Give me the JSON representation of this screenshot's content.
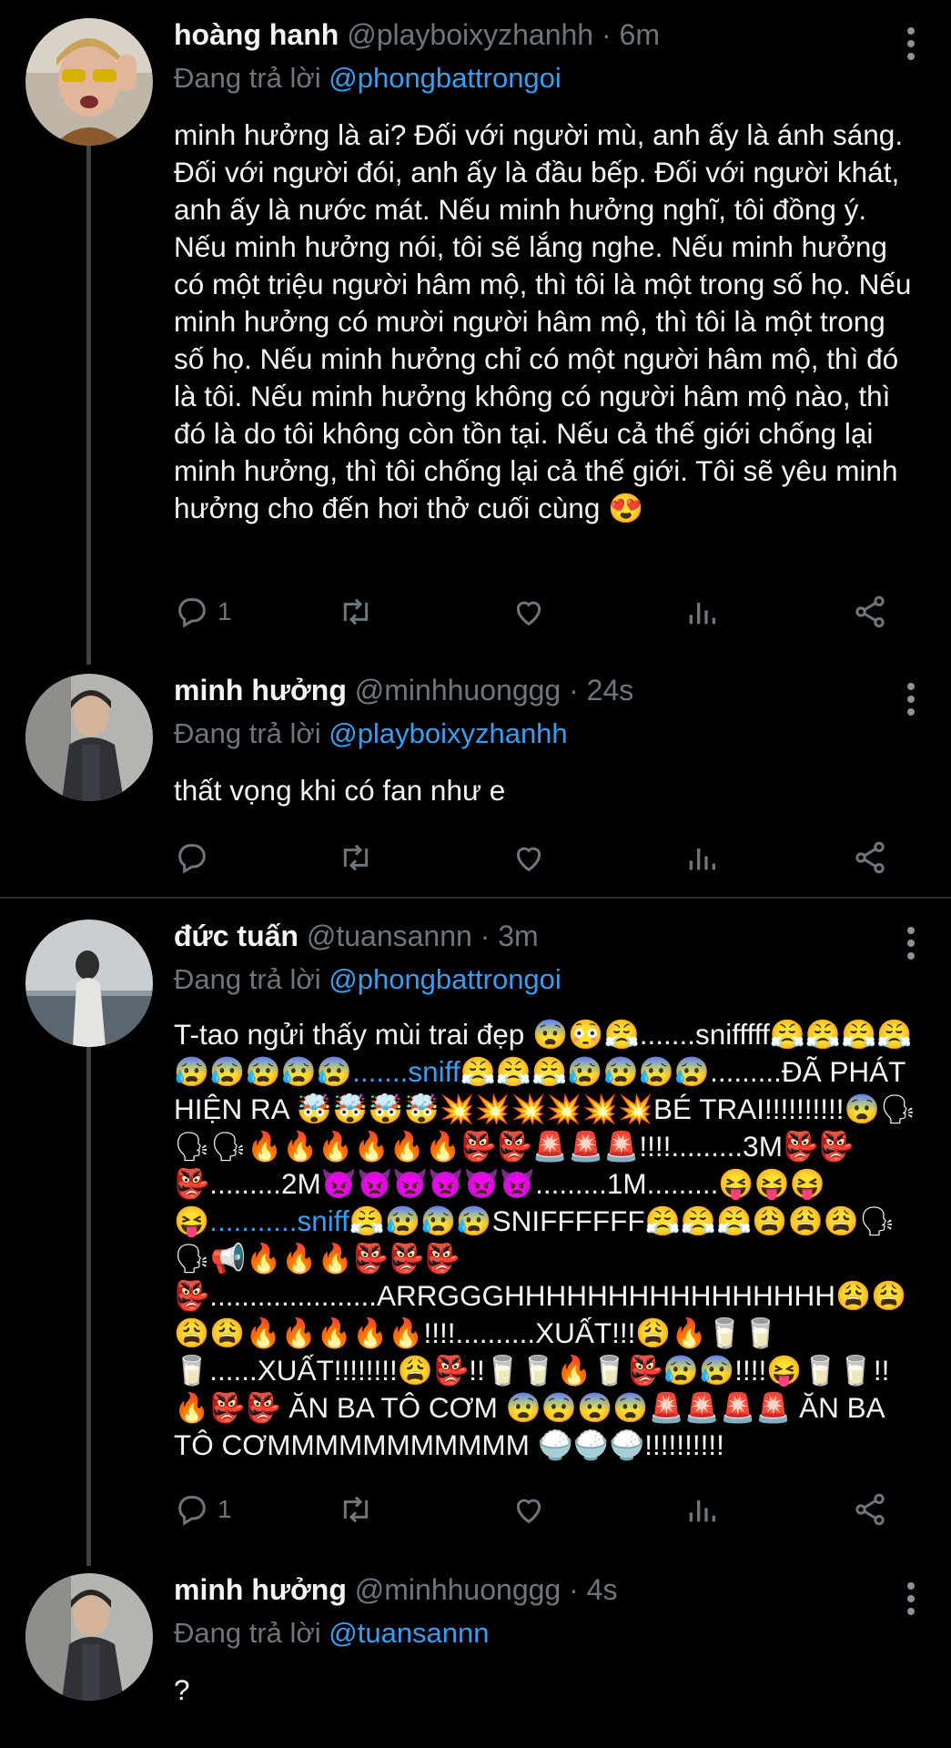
{
  "tweets": [
    {
      "name": "hoàng hanh",
      "handle": "@playboixyzhanhh",
      "time": "· 6m",
      "reply_prefix": "Đang trả lời",
      "reply_to": "@phongbattrongoi",
      "text": "minh hưởng là ai? Đối với người mù, anh ấy là ánh sáng. Đối với người đói, anh ấy là đầu bếp. Đối với người khát, anh ấy là nước mát. Nếu minh hưởng nghĩ, tôi đồng ý. Nếu minh hưởng nói, tôi sẽ lắng nghe. Nếu minh hưởng có một triệu người hâm mộ, thì tôi là một trong số họ. Nếu minh hưởng có mười người hâm mộ, thì tôi là một trong số họ. Nếu minh hưởng chỉ có một người hâm mộ, thì đó là tôi. Nếu minh hưởng không có người hâm mộ nào, thì đó là do tôi không còn tồn tại. Nếu cả thế giới chống lại minh hưởng, thì tôi chống lại cả thế giới. Tôi sẽ yêu minh hưởng cho đến hơi thở cuối cùng 😍",
      "reply_count": "1"
    },
    {
      "name": "minh hưởng",
      "handle": "@minhhuonggg",
      "time": "· 24s",
      "reply_prefix": "Đang trả lời",
      "reply_to": "@playboixyzhanhh",
      "text": "thất vọng khi có fan như e",
      "reply_count": ""
    },
    {
      "name": "đức tuấn",
      "handle": "@tuansannn",
      "time": "· 3m",
      "reply_prefix": "Đang trả lời",
      "reply_to": "@phongbattrongoi",
      "text_parts": [
        "T-tao ngửi thấy mùi trai đẹp 😨😳😤.......snifffff😤😤😤😤😰😰😰😰😰",
        ".......sniff",
        "😤😤😤😰😰😰😰.........ĐÃ PHÁT HIỆN RA 🤯🤯🤯🤯💥💥💥💥💥💥BÉ TRAI!!!!!!!!!!😨🗣🗣🗣🔥🔥🔥🔥🔥🔥👺👺🚨🚨🚨!!!!.........3M👺👺👺.........2M👿👿👿👿👿👿.........1M.........😝😝😝😝",
        "...........sniff",
        "😤😰😰😰SNIFFFFFF😤😤😤😩😩😩🗣🗣📢🔥🔥🔥👺👺👺👺.....................ARRGGGHHHHHHHHHHHHHHHH😩😩😩😩🔥🔥🔥🔥🔥!!!!..........XUẤT!!!😩🔥🥛🥛🥛......XUẤT!!!!!!!!😩👺!!🥛🥛🔥🥛👺😰😰!!!!😝🥛🥛!!🔥👺👺 ĂN BA TÔ CƠM 😨😨😨😨🚨🚨🚨🚨 ĂN BA TÔ CƠMMMMMMMMMMM 🍚🍚🍚!!!!!!!!!!"
      ],
      "reply_count": "1"
    },
    {
      "name": "minh hưởng",
      "handle": "@minhhuonggg",
      "time": "· 4s",
      "reply_prefix": "Đang trả lời",
      "reply_to": "@tuansannn",
      "text": "?",
      "reply_count": ""
    }
  ],
  "icons": {
    "reply": "reply-icon",
    "retweet": "retweet-icon",
    "like": "heart-icon",
    "analytics": "analytics-icon",
    "share": "share-icon",
    "more": "more-dots-icon"
  }
}
